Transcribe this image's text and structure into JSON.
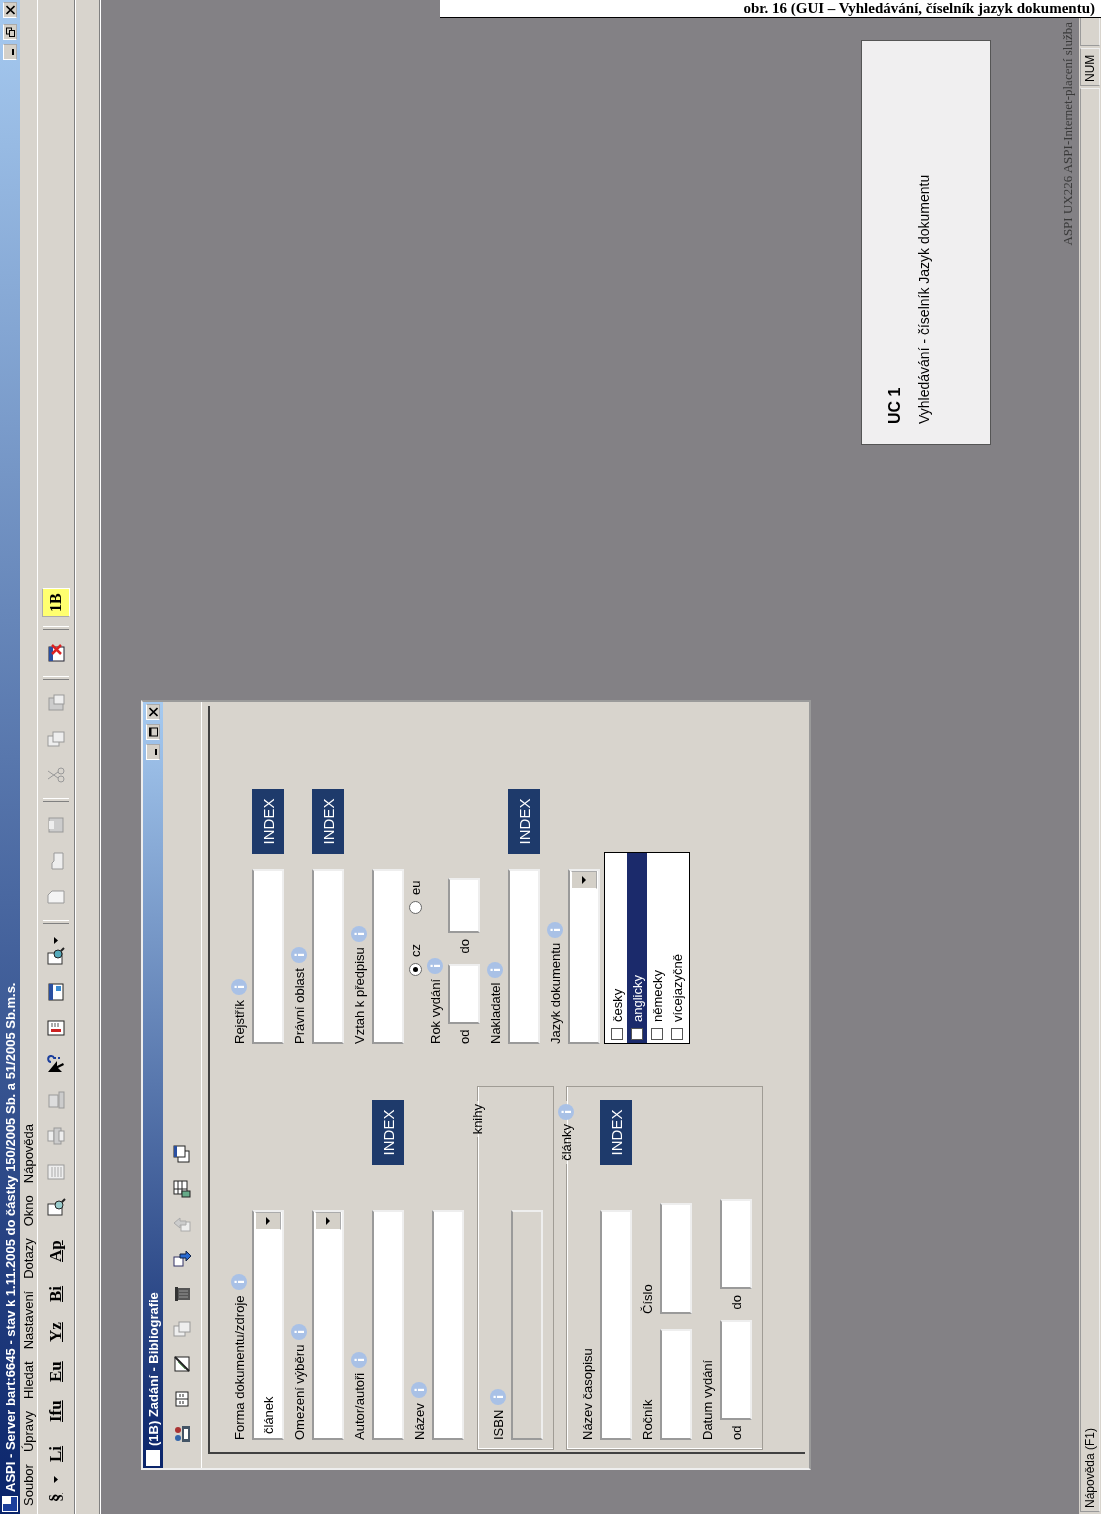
{
  "caption": "obr. 16 (GUI – Vyhledávání, číselník jazyk dokumentu)",
  "window": {
    "title": "ASPI - Server bart:6645 - stav k 1.11.2005 do částky 150/2005 Sb. a 51/2005 Sb.m.s."
  },
  "menu": [
    "Soubor",
    "Úpravy",
    "Hledat",
    "Nastavení",
    "Dotazy",
    "Okno",
    "Nápověda"
  ],
  "toolbar": {
    "text_buttons": [
      {
        "label": "§",
        "dropdown": true
      },
      {
        "label": "Li",
        "dropdown": false
      },
      {
        "label": "Ifu",
        "dropdown": false
      },
      {
        "label": "Eu",
        "dropdown": false
      },
      {
        "label": "Yz",
        "dropdown": false
      },
      {
        "label": "Bi",
        "dropdown": false
      },
      {
        "label": "Ap",
        "dropdown": false
      }
    ],
    "tool_button": "1B"
  },
  "dialog": {
    "title": "(1B) Zadání - Bibliografie",
    "left": [
      {
        "kind": "combo",
        "label": "Forma dokumentu/zdroje",
        "info": true,
        "disabled": false,
        "value": "článek"
      },
      {
        "kind": "combo",
        "label": "Omezení výběru",
        "info": true,
        "disabled": false
      },
      {
        "kind": "text",
        "label": "Autor/autoři",
        "info": true,
        "disabled": false,
        "index_button": "INDEX"
      },
      {
        "kind": "text",
        "label": "Název",
        "info": true,
        "disabled": false
      }
    ],
    "groups": [
      {
        "legend": "knihy",
        "info": false,
        "fields": [
          {
            "kind": "text",
            "label": "ISBN",
            "info": true,
            "disabled": true
          }
        ]
      },
      {
        "legend": "články",
        "info": true,
        "fields": [
          {
            "kind": "text",
            "label": "Název časopisu",
            "info": false,
            "disabled": false,
            "index_button": "INDEX"
          },
          {
            "kind": "pair",
            "fields": [
              {
                "label": "Ročník"
              },
              {
                "label": "Číslo"
              }
            ]
          },
          {
            "kind": "range",
            "label": "Datum vydání",
            "info": false,
            "from_label": "od",
            "to_label": "do"
          }
        ]
      }
    ],
    "right": [
      {
        "kind": "text",
        "label": "Rejstřík",
        "info": true,
        "disabled": false,
        "index_button": "INDEX"
      },
      {
        "kind": "text",
        "label": "Právní oblast",
        "info": true,
        "disabled": false,
        "index_button": "INDEX"
      },
      {
        "kind": "text",
        "label": "Vztah k předpisu",
        "info": true,
        "disabled": false
      },
      {
        "kind": "radios",
        "options": [
          {
            "label": "cz",
            "selected": true
          },
          {
            "label": "eu",
            "selected": false
          }
        ]
      },
      {
        "kind": "range",
        "label": "Rok vydání",
        "info": true,
        "from_label": "od",
        "to_label": "do"
      },
      {
        "kind": "text",
        "label": "Nakladatel",
        "info": true,
        "disabled": false,
        "index_button": "INDEX"
      },
      {
        "kind": "combo",
        "label": "Jazyk dokumentu",
        "info": true,
        "disabled": false
      },
      {
        "kind": "checklist",
        "items": [
          {
            "label": "česky",
            "checked": false,
            "selected": false
          },
          {
            "label": "anglicky",
            "checked": false,
            "selected": true
          },
          {
            "label": "německy",
            "checked": false,
            "selected": false
          },
          {
            "label": "vícejazyčně",
            "checked": false,
            "selected": false
          }
        ]
      }
    ]
  },
  "note": {
    "title": "UC 1",
    "text": "Vyhledávání - číselník Jazyk dokumentu"
  },
  "desktop_label": "ASPI UX226 ASPI-Internet-placení služba",
  "status_bar": {
    "help": "Nápověda (F1)",
    "indicator": "NUM"
  }
}
